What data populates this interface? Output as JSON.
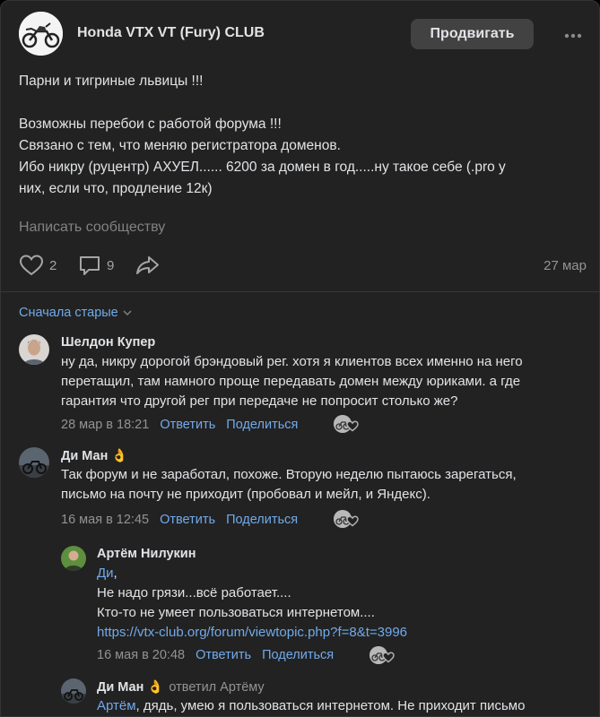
{
  "community": {
    "name": "Honda VTX VT (Fury) CLUB",
    "promote_label": "Продвигать"
  },
  "post": {
    "lines": [
      "Парни и тигриные львицы !!!",
      "",
      "Возможны перебои с работой форума !!!",
      "Связано с тем, что меняю регистратора доменов.",
      "Ибо никру (руцентр) АХУЕЛ...... 6200 за домен в год.....ну такое себе (.pro у",
      "них, если что, продление 12к)"
    ],
    "write_placeholder": "Написать сообществу",
    "likes": "2",
    "comments": "9",
    "date": "27 мар"
  },
  "sort_label": "Сначала старые",
  "reply_label": "Ответить",
  "share_label": "Поделиться",
  "comments": [
    {
      "author": "Шелдон Купер",
      "lines": [
        "ну да, никру дорогой брэндовый рег. хотя я клиентов всех именно на него",
        "перетащил, там намного проще передавать домен между юриками. а где",
        "гарантия что другой рег при передаче не попросит столько же?"
      ],
      "time": "28 мар в 18:21"
    },
    {
      "author": "Ди Ман",
      "emoji": "👌",
      "lines": [
        "Так форум и не заработал, похоже. Вторую неделю пытаюсь зарегаться,",
        "письмо на почту не приходит (пробовал и мейл, и Яндекс)."
      ],
      "time": "16 мая в 12:45"
    },
    {
      "author": "Артём Нилукин",
      "mention": "Ди",
      "mention_suffix": ",",
      "lines": [
        "Не надо грязи...всё работает....",
        "Кто-то не умеет пользоваться интернетом...."
      ],
      "link": "https://vtx-club.org/forum/viewtopic.php?f=8&t=3996",
      "time": "16 мая в 20:48"
    },
    {
      "author": "Ди Ман",
      "emoji": "👌",
      "replied_to": "ответил Артёму",
      "mention": "Артём",
      "line": ", дядь, умею я пользоваться интернетом. Не приходит письмо"
    }
  ],
  "colors": {
    "background": "#222222",
    "link": "#71aaeb",
    "secondary": "#939393"
  }
}
